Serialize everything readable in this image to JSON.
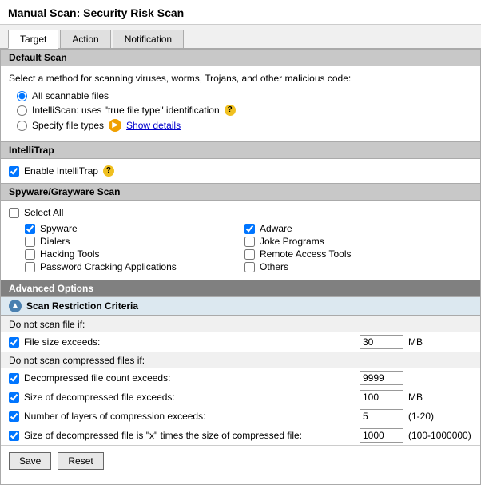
{
  "page": {
    "title": "Manual Scan: Security Risk Scan",
    "tabs": [
      {
        "label": "Target",
        "active": true
      },
      {
        "label": "Action",
        "active": false
      },
      {
        "label": "Notification",
        "active": false
      }
    ]
  },
  "default_scan": {
    "header": "Default Scan",
    "description": "Select a method for scanning viruses, worms, Trojans, and other malicious code:",
    "options": [
      {
        "label": "All scannable files",
        "selected": true
      },
      {
        "label": "IntelliScan: uses \"true file type\" identification",
        "selected": false
      },
      {
        "label": "Specify file types",
        "selected": false
      }
    ],
    "show_details_label": "Show details"
  },
  "intellitrap": {
    "header": "IntelliTrap",
    "enable_label": "Enable IntelliTrap",
    "enabled": true
  },
  "spyware": {
    "header": "Spyware/Grayware Scan",
    "select_all_label": "Select All",
    "select_all_checked": false,
    "items_left": [
      {
        "label": "Spyware",
        "checked": true
      },
      {
        "label": "Dialers",
        "checked": false
      },
      {
        "label": "Hacking Tools",
        "checked": false
      },
      {
        "label": "Password Cracking Applications",
        "checked": false
      }
    ],
    "items_right": [
      {
        "label": "Adware",
        "checked": true
      },
      {
        "label": "Joke Programs",
        "checked": false
      },
      {
        "label": "Remote Access Tools",
        "checked": false
      },
      {
        "label": "Others",
        "checked": false
      }
    ]
  },
  "advanced_options": {
    "header": "Advanced Options",
    "scan_restriction": {
      "header": "Scan Restriction Criteria",
      "do_not_scan_label": "Do not scan file if:",
      "file_size_label": "File size exceeds:",
      "file_size_value": "30",
      "file_size_unit": "MB",
      "file_size_checked": true,
      "do_not_scan_compressed_label": "Do not scan compressed files if:",
      "compressed_rows": [
        {
          "label": "Decompressed file count exceeds:",
          "value": "9999",
          "unit": "",
          "checked": true
        },
        {
          "label": "Size of decompressed file exceeds:",
          "value": "100",
          "unit": "MB",
          "checked": true
        },
        {
          "label": "Number of layers of compression exceeds:",
          "value": "5",
          "unit": "(1-20)",
          "checked": true
        },
        {
          "label": "Size of decompressed file is \"x\" times the size of compressed file:",
          "value": "1000",
          "unit": "(100-1000000)",
          "checked": true
        }
      ]
    }
  },
  "footer": {
    "save_label": "Save",
    "reset_label": "Reset"
  }
}
